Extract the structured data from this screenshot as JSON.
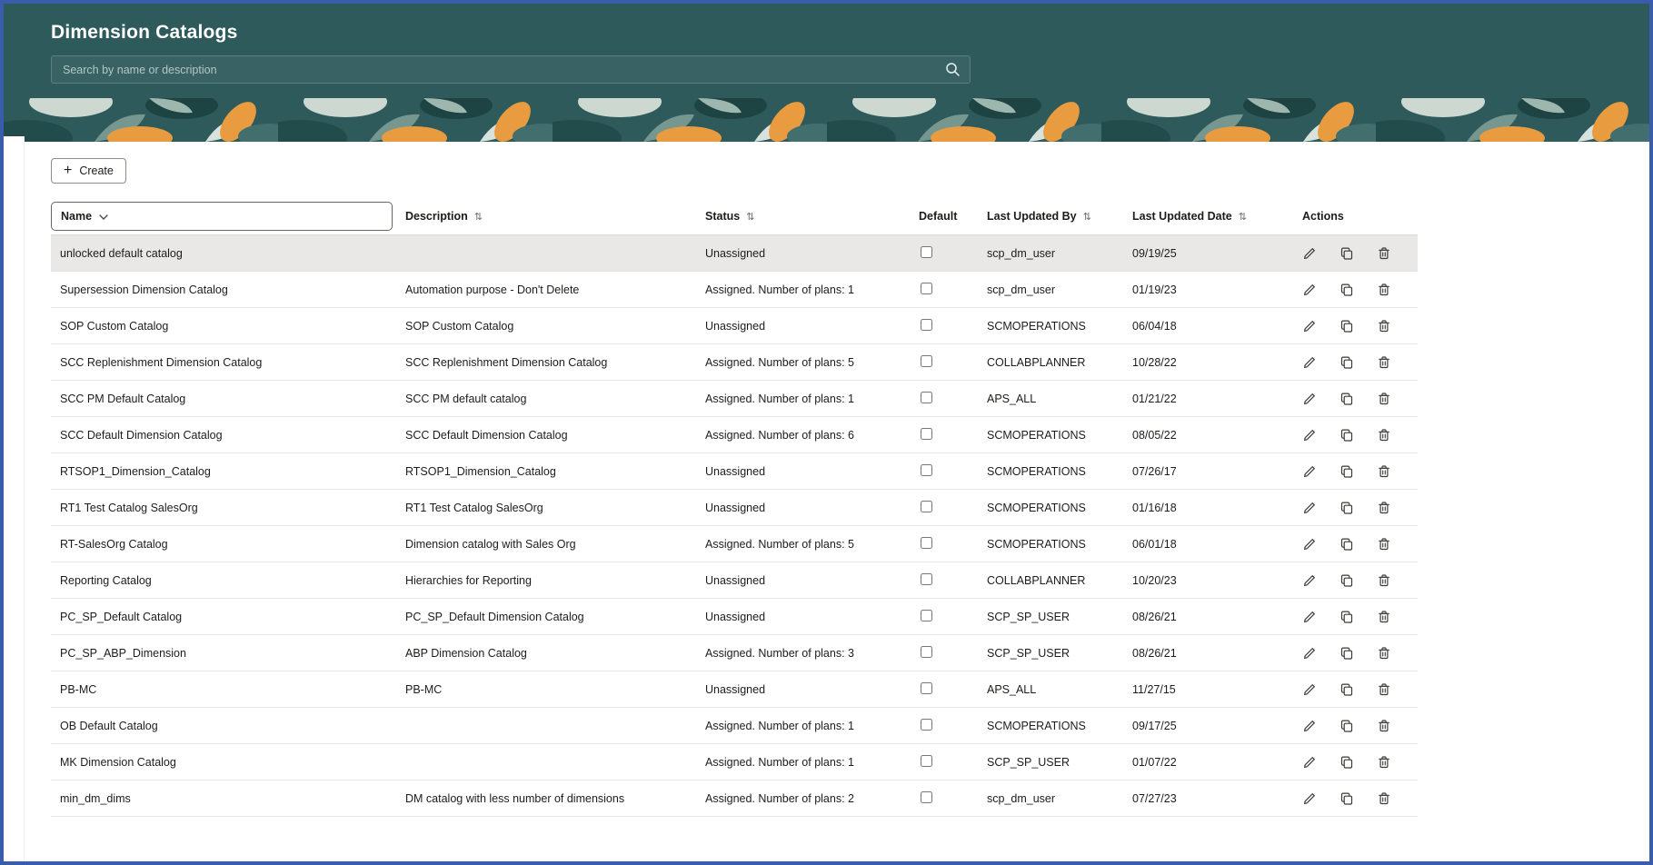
{
  "page": {
    "title": "Dimension Catalogs"
  },
  "colors": {
    "header_teal": "#2e5a5c",
    "frame_border_blue": "#3a5dab",
    "selected_row": "#e9e8e6",
    "banner_orange": "#e89c3f",
    "banner_sage": "#cdd9d0"
  },
  "icons": {
    "plus": "+",
    "sort": "⇅"
  },
  "search": {
    "placeholder": "Search by name or description",
    "value": ""
  },
  "toolbar": {
    "create_label": "Create"
  },
  "table": {
    "columns": [
      {
        "label": "Name",
        "sortable": true
      },
      {
        "label": "Description",
        "sortable": true
      },
      {
        "label": "Status",
        "sortable": true
      },
      {
        "label": "Default",
        "sortable": false
      },
      {
        "label": "Last Updated By",
        "sortable": true
      },
      {
        "label": "Last Updated Date",
        "sortable": true
      },
      {
        "label": "Actions",
        "sortable": false
      }
    ],
    "rows": [
      {
        "name": "unlocked default catalog",
        "description": "",
        "status": "Unassigned",
        "default": false,
        "last_updated_by": "scp_dm_user",
        "last_updated_date": "09/19/25",
        "selected": true
      },
      {
        "name": "Supersession Dimension Catalog",
        "description": "Automation purpose - Don't Delete",
        "status": "Assigned. Number of plans: 1",
        "default": false,
        "last_updated_by": "scp_dm_user",
        "last_updated_date": "01/19/23",
        "selected": false
      },
      {
        "name": "SOP Custom Catalog",
        "description": "SOP Custom Catalog",
        "status": "Unassigned",
        "default": false,
        "last_updated_by": "SCMOPERATIONS",
        "last_updated_date": "06/04/18",
        "selected": false
      },
      {
        "name": "SCC Replenishment Dimension Catalog",
        "description": "SCC Replenishment Dimension Catalog",
        "status": "Assigned. Number of plans: 5",
        "default": false,
        "last_updated_by": "COLLABPLANNER",
        "last_updated_date": "10/28/22",
        "selected": false
      },
      {
        "name": "SCC PM Default Catalog",
        "description": "SCC PM default catalog",
        "status": "Assigned. Number of plans: 1",
        "default": false,
        "last_updated_by": "APS_ALL",
        "last_updated_date": "01/21/22",
        "selected": false
      },
      {
        "name": "SCC Default Dimension Catalog",
        "description": "SCC Default Dimension Catalog",
        "status": "Assigned. Number of plans: 6",
        "default": false,
        "last_updated_by": "SCMOPERATIONS",
        "last_updated_date": "08/05/22",
        "selected": false
      },
      {
        "name": "RTSOP1_Dimension_Catalog",
        "description": "RTSOP1_Dimension_Catalog",
        "status": "Unassigned",
        "default": false,
        "last_updated_by": "SCMOPERATIONS",
        "last_updated_date": "07/26/17",
        "selected": false
      },
      {
        "name": "RT1 Test Catalog SalesOrg",
        "description": "RT1 Test Catalog SalesOrg",
        "status": "Unassigned",
        "default": false,
        "last_updated_by": "SCMOPERATIONS",
        "last_updated_date": "01/16/18",
        "selected": false
      },
      {
        "name": "RT-SalesOrg Catalog",
        "description": "Dimension catalog with Sales Org",
        "status": "Assigned. Number of plans: 5",
        "default": false,
        "last_updated_by": "SCMOPERATIONS",
        "last_updated_date": "06/01/18",
        "selected": false
      },
      {
        "name": "Reporting Catalog",
        "description": "Hierarchies for Reporting",
        "status": "Unassigned",
        "default": false,
        "last_updated_by": "COLLABPLANNER",
        "last_updated_date": "10/20/23",
        "selected": false
      },
      {
        "name": "PC_SP_Default Catalog",
        "description": "PC_SP_Default Dimension Catalog",
        "status": "Unassigned",
        "default": false,
        "last_updated_by": "SCP_SP_USER",
        "last_updated_date": "08/26/21",
        "selected": false
      },
      {
        "name": "PC_SP_ABP_Dimension",
        "description": "ABP Dimension Catalog",
        "status": "Assigned. Number of plans: 3",
        "default": false,
        "last_updated_by": "SCP_SP_USER",
        "last_updated_date": "08/26/21",
        "selected": false
      },
      {
        "name": "PB-MC",
        "description": "PB-MC",
        "status": "Unassigned",
        "default": false,
        "last_updated_by": "APS_ALL",
        "last_updated_date": "11/27/15",
        "selected": false
      },
      {
        "name": "OB Default Catalog",
        "description": "",
        "status": "Assigned. Number of plans: 1",
        "default": false,
        "last_updated_by": "SCMOPERATIONS",
        "last_updated_date": "09/17/25",
        "selected": false
      },
      {
        "name": "MK Dimension Catalog",
        "description": "",
        "status": "Assigned. Number of plans: 1",
        "default": false,
        "last_updated_by": "SCP_SP_USER",
        "last_updated_date": "01/07/22",
        "selected": false
      },
      {
        "name": "min_dm_dims",
        "description": "DM catalog with less number of dimensions",
        "status": "Assigned. Number of plans: 2",
        "default": false,
        "last_updated_by": "scp_dm_user",
        "last_updated_date": "07/27/23",
        "selected": false
      }
    ]
  }
}
